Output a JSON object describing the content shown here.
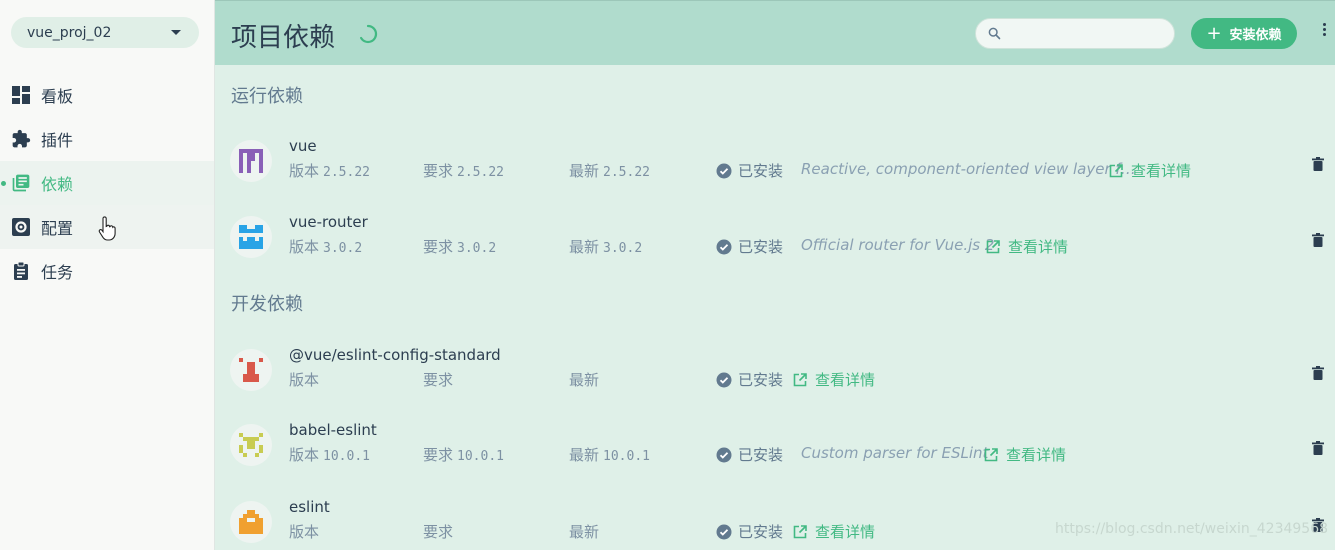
{
  "sidebar": {
    "project": "vue_proj_02",
    "items": [
      {
        "label": "看板",
        "icon": "dashboard-icon"
      },
      {
        "label": "插件",
        "icon": "puzzle-icon"
      },
      {
        "label": "依赖",
        "icon": "library-books-icon"
      },
      {
        "label": "配置",
        "icon": "gear-icon"
      },
      {
        "label": "任务",
        "icon": "clipboard-icon"
      }
    ],
    "active_index": 2
  },
  "header": {
    "title": "项目依赖",
    "search_placeholder": "",
    "add_label": "安装依赖"
  },
  "sections": {
    "runtime_title": "运行依赖",
    "dev_title": "开发依赖"
  },
  "labels": {
    "version": "版本",
    "wanted": "要求",
    "latest": "最新",
    "installed": "已安装",
    "details": "查看详情"
  },
  "runtime": [
    {
      "name": "vue",
      "version": "2.5.22",
      "wanted": "2.5.22",
      "latest": "2.5.22",
      "description": "Reactive, component-oriented view layer f…"
    },
    {
      "name": "vue-router",
      "version": "3.0.2",
      "wanted": "3.0.2",
      "latest": "3.0.2",
      "description": "Official router for Vue.js 2"
    }
  ],
  "dev": [
    {
      "name": "@vue/eslint-config-standard",
      "version": "",
      "wanted": "",
      "latest": "",
      "description": ""
    },
    {
      "name": "babel-eslint",
      "version": "10.0.1",
      "wanted": "10.0.1",
      "latest": "10.0.1",
      "description": "Custom parser for ESLint"
    },
    {
      "name": "eslint",
      "version": "",
      "wanted": "",
      "latest": "",
      "description": ""
    }
  ],
  "colors": {
    "accent": "#42b983",
    "header_bg": "#b0dccd",
    "main_bg": "#dff0e8",
    "text": "#2c3e50"
  },
  "watermark": "https://blog.csdn.net/weixin_42349568"
}
